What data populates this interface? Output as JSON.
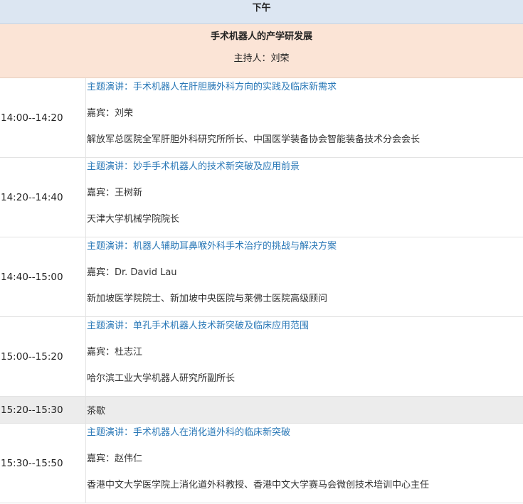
{
  "header": {
    "label": "下午"
  },
  "session": {
    "title": "手术机器人的产学研发展",
    "host": "主持人：刘荣"
  },
  "rows": [
    {
      "time": "14:00--14:20",
      "topic": "主题演讲：手术机器人在肝胆胰外科方向的实践及临床新需求",
      "speaker": "嘉宾：刘荣",
      "affiliation": "解放军总医院全军肝胆外科研究所所长、中国医学装备协会智能装备技术分会会长"
    },
    {
      "time": "14:20--14:40",
      "topic": "主题演讲：妙手手术机器人的技术新突破及应用前景",
      "speaker": "嘉宾：王树新",
      "affiliation": "天津大学机械学院院长"
    },
    {
      "time": "14:40--15:00",
      "topic": "主题演讲：机器人辅助耳鼻喉外科手术治疗的挑战与解决方案",
      "speaker": "嘉宾：Dr. David Lau",
      "affiliation": "新加坡医学院院士、新加坡中央医院与莱佛士医院高级顾问"
    },
    {
      "time": "15:00--15:20",
      "topic": "主题演讲：单孔手术机器人技术新突破及临床应用范围",
      "speaker": "嘉宾：杜志江",
      "affiliation": "哈尔滨工业大学机器人研究所副所长"
    },
    {
      "time": "15:20--15:30",
      "label": "茶歇"
    },
    {
      "time": "15:30--15:50",
      "topic": "主题演讲：手术机器人在消化道外科的临床新突破",
      "speaker": "嘉宾：赵伟仁",
      "affiliation": "香港中文大学医学院上消化道外科教授、香港中文大学赛马会微创技术培训中心主任"
    }
  ]
}
